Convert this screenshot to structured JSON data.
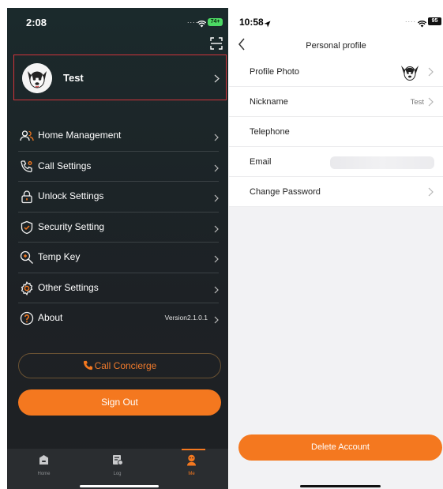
{
  "left": {
    "status": {
      "time": "2:08",
      "battery": "74+"
    },
    "profile": {
      "name": "Test"
    },
    "menu": [
      {
        "label": "Home Management",
        "icon": "home-people-icon"
      },
      {
        "label": "Call Settings",
        "icon": "phone-settings-icon"
      },
      {
        "label": "Unlock Settings",
        "icon": "lock-icon"
      },
      {
        "label": "Security Setting",
        "icon": "shield-icon"
      },
      {
        "label": "Temp Key",
        "icon": "key-search-icon"
      },
      {
        "label": "Other Settings",
        "icon": "gear-icon"
      },
      {
        "label": "About",
        "icon": "question-circle-icon",
        "version": "Version2.1.0.1"
      }
    ],
    "concierge_label": "Call Concierge",
    "signout_label": "Sign Out",
    "tabs": [
      {
        "label": "Home",
        "icon": "home-icon"
      },
      {
        "label": "Log",
        "icon": "log-icon"
      },
      {
        "label": "Me",
        "icon": "me-icon",
        "active": true
      }
    ],
    "accent": "#f4781f"
  },
  "right": {
    "status": {
      "time": "10:58",
      "battery": "95"
    },
    "title": "Personal profile",
    "rows": [
      {
        "label": "Profile Photo"
      },
      {
        "label": "Nickname",
        "value": "Test"
      },
      {
        "label": "Telephone"
      },
      {
        "label": "Email"
      },
      {
        "label": "Change Password"
      }
    ],
    "delete_label": "Delete Account"
  }
}
